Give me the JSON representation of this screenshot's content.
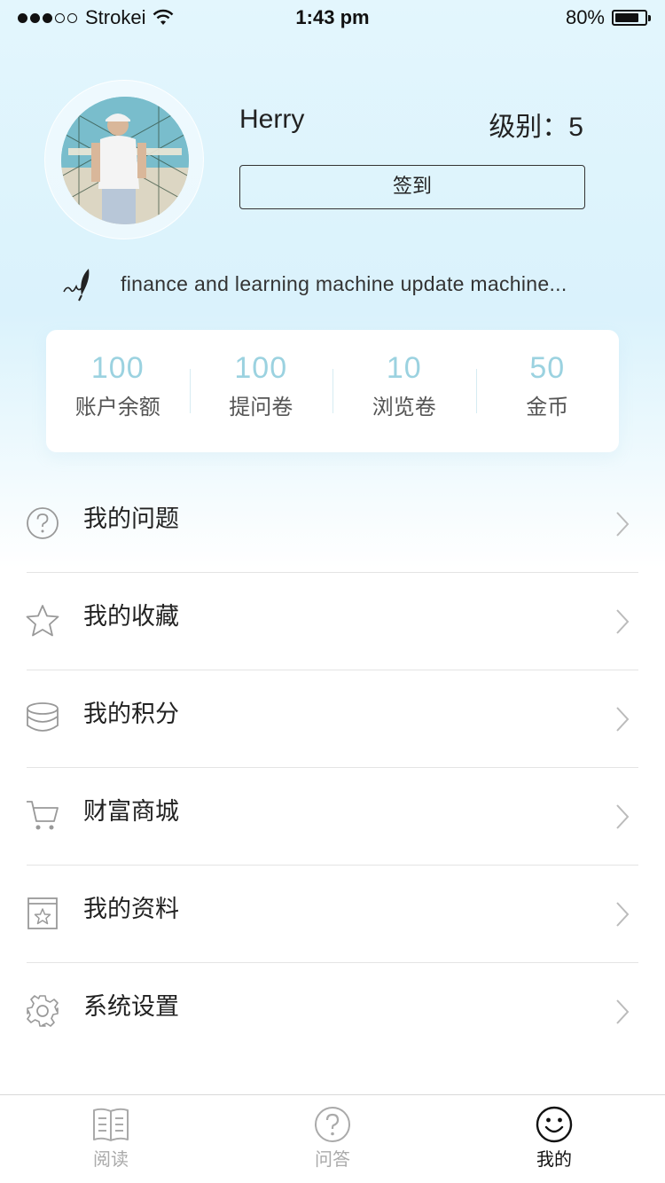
{
  "status_bar": {
    "carrier": "Strokei",
    "time": "1:43 pm",
    "battery": "80%",
    "battery_level": 0.8,
    "signal_bars": 3
  },
  "profile": {
    "username": "Herry",
    "level": "级别：5",
    "checkin_label": "签到",
    "signature": "finance and learning machine update machine..."
  },
  "stats": [
    {
      "value": "100",
      "label": "账户余额"
    },
    {
      "value": "100",
      "label": "提问卷"
    },
    {
      "value": "10",
      "label": "浏览卷"
    },
    {
      "value": "50",
      "label": "金币"
    }
  ],
  "menu": [
    {
      "label": "我的问题",
      "icon": "question-circle-icon"
    },
    {
      "label": "我的收藏",
      "icon": "star-icon"
    },
    {
      "label": "我的积分",
      "icon": "coins-icon"
    },
    {
      "label": "财富商城",
      "icon": "cart-icon"
    },
    {
      "label": "我的资料",
      "icon": "profile-book-icon"
    },
    {
      "label": "系统设置",
      "icon": "gear-icon"
    }
  ],
  "tabs": [
    {
      "label": "阅读",
      "icon": "book-icon",
      "active": false
    },
    {
      "label": "问答",
      "icon": "question-circle-icon",
      "active": false
    },
    {
      "label": "我的",
      "icon": "smiley-icon",
      "active": true
    }
  ],
  "colors": {
    "hero_bg": "#dff4fc",
    "stat_value": "#9bd2e0",
    "active_tab": "#111111",
    "inactive_tab": "#aaaaaa"
  }
}
